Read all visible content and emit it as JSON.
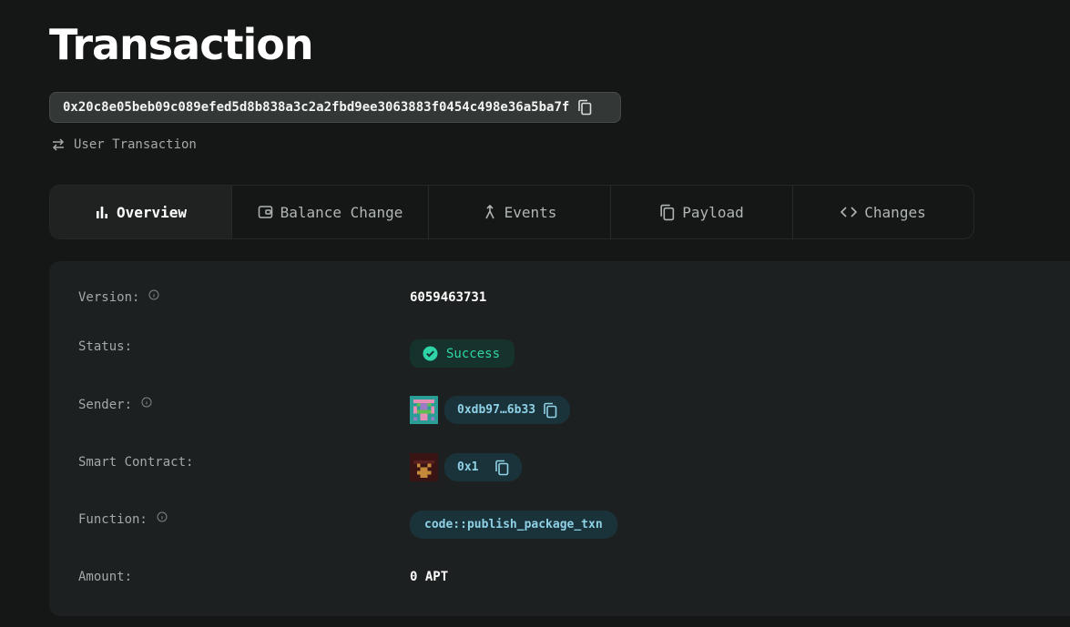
{
  "page": {
    "title": "Transaction"
  },
  "transaction": {
    "hash": "0x20c8e05beb09c089efed5d8b838a3c2a2fbd9ee3063883f0454c498e36a5ba7f",
    "type_label": "User Transaction"
  },
  "tabs": [
    {
      "label": "Overview",
      "icon": "bar-chart-icon",
      "active": true
    },
    {
      "label": "Balance Change",
      "icon": "wallet-icon",
      "active": false
    },
    {
      "label": "Events",
      "icon": "merge-icon",
      "active": false
    },
    {
      "label": "Payload",
      "icon": "copy-icon",
      "active": false
    },
    {
      "label": "Changes",
      "icon": "code-icon",
      "active": false
    }
  ],
  "overview": {
    "version": {
      "label": "Version:",
      "value": "6059463731"
    },
    "status": {
      "label": "Status:",
      "value": "Success"
    },
    "sender": {
      "label": "Sender:",
      "value": "0xdb97…6b33"
    },
    "smart_contract": {
      "label": "Smart Contract:",
      "value": "0x1"
    },
    "function": {
      "label": "Function:",
      "value": "code::publish_package_txn"
    },
    "amount": {
      "label": "Amount:",
      "value": "0 APT"
    }
  },
  "colors": {
    "background": "#151717",
    "card": "#1d2020",
    "success": "#2fd5a6",
    "address_text": "#8fd1e6",
    "address_pill": "#1a3239"
  }
}
